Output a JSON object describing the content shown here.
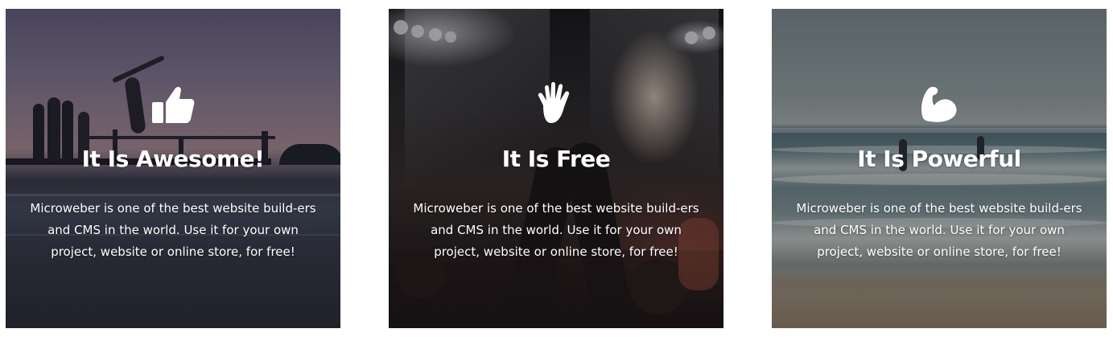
{
  "cards": [
    {
      "icon": "thumbs-up-icon",
      "title": "It Is Awesome!",
      "description": "Microweber is one of the best website build-ers and CMS in the world. Use it for your own project, website or online store, for free!"
    },
    {
      "icon": "raised-hand-icon",
      "title": "It Is Free",
      "description": "Microweber is one of the best website build-ers and CMS in the world. Use it for your own project, website or online store, for free!"
    },
    {
      "icon": "flexed-biceps-icon",
      "title": "It Is Powerful",
      "description": "Microweber is one of the best website build-ers and CMS in the world. Use it for your own project, website or online store, for free!"
    }
  ]
}
